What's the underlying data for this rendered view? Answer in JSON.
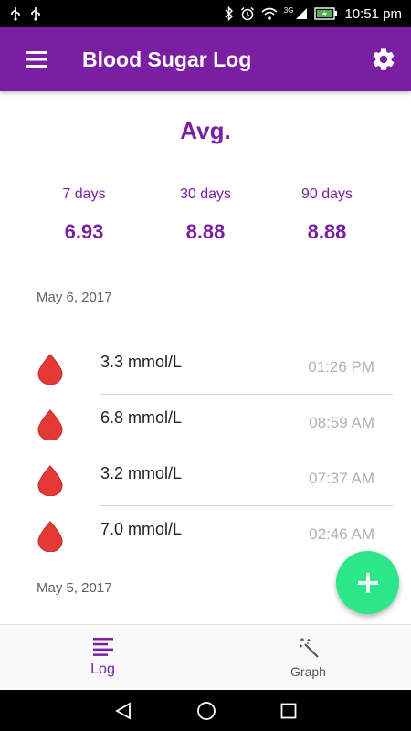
{
  "status_bar": {
    "time": "10:51 pm",
    "network": "3G"
  },
  "app_bar": {
    "title": "Blood Sugar Log",
    "bg_color": "#7b1fa2",
    "icons": [
      "menu-icon",
      "gear-icon"
    ]
  },
  "averages": {
    "title": "Avg.",
    "columns": [
      {
        "label": "7 days",
        "value": "6.93"
      },
      {
        "label": "30 days",
        "value": "8.88"
      },
      {
        "label": "90 days",
        "value": "8.88"
      }
    ]
  },
  "log": {
    "groups": [
      {
        "date": "May 6, 2017",
        "entries": [
          {
            "value": "3.3 mmol/L",
            "time": "01:26 PM"
          },
          {
            "value": "6.8 mmol/L",
            "time": "08:59 AM"
          },
          {
            "value": "3.2 mmol/L",
            "time": "07:37 AM"
          },
          {
            "value": "7.0 mmol/L",
            "time": "02:46 AM"
          }
        ]
      },
      {
        "date": "May 5, 2017",
        "entries": []
      }
    ],
    "drop_color": "#e53935"
  },
  "fab": {
    "icon": "plus-icon",
    "color": "#2be78a"
  },
  "bottom_nav": {
    "items": [
      {
        "label": "Log",
        "icon": "list-icon",
        "active": true
      },
      {
        "label": "Graph",
        "icon": "magic-wand-icon",
        "active": false
      }
    ]
  },
  "system_nav": {
    "icons": [
      "back-icon",
      "home-icon",
      "recents-icon"
    ]
  }
}
